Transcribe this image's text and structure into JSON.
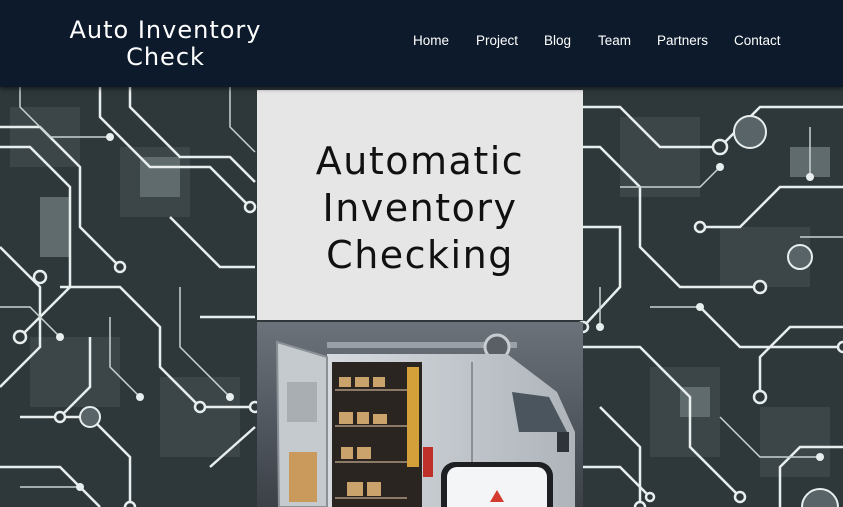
{
  "site": {
    "brand_line1": "Auto Inventory",
    "brand_line2": "Check"
  },
  "nav": {
    "items": [
      {
        "label": "Home"
      },
      {
        "label": "Project"
      },
      {
        "label": "Blog"
      },
      {
        "label": "Team"
      },
      {
        "label": "Partners"
      },
      {
        "label": "Contact"
      }
    ]
  },
  "hero": {
    "title_line1": "Automatic",
    "title_line2": "Inventory",
    "title_line3": "Checking"
  },
  "colors": {
    "navbar_bg": "#0c1a2c",
    "hero_box_bg": "#e6e6e6",
    "circuit_dark": "#2a3336",
    "circuit_trace": "#e8eeee"
  },
  "images": {
    "background": "circuit-board-pattern",
    "hero": "open-delivery-van-with-shelves-and-phone-alert"
  }
}
